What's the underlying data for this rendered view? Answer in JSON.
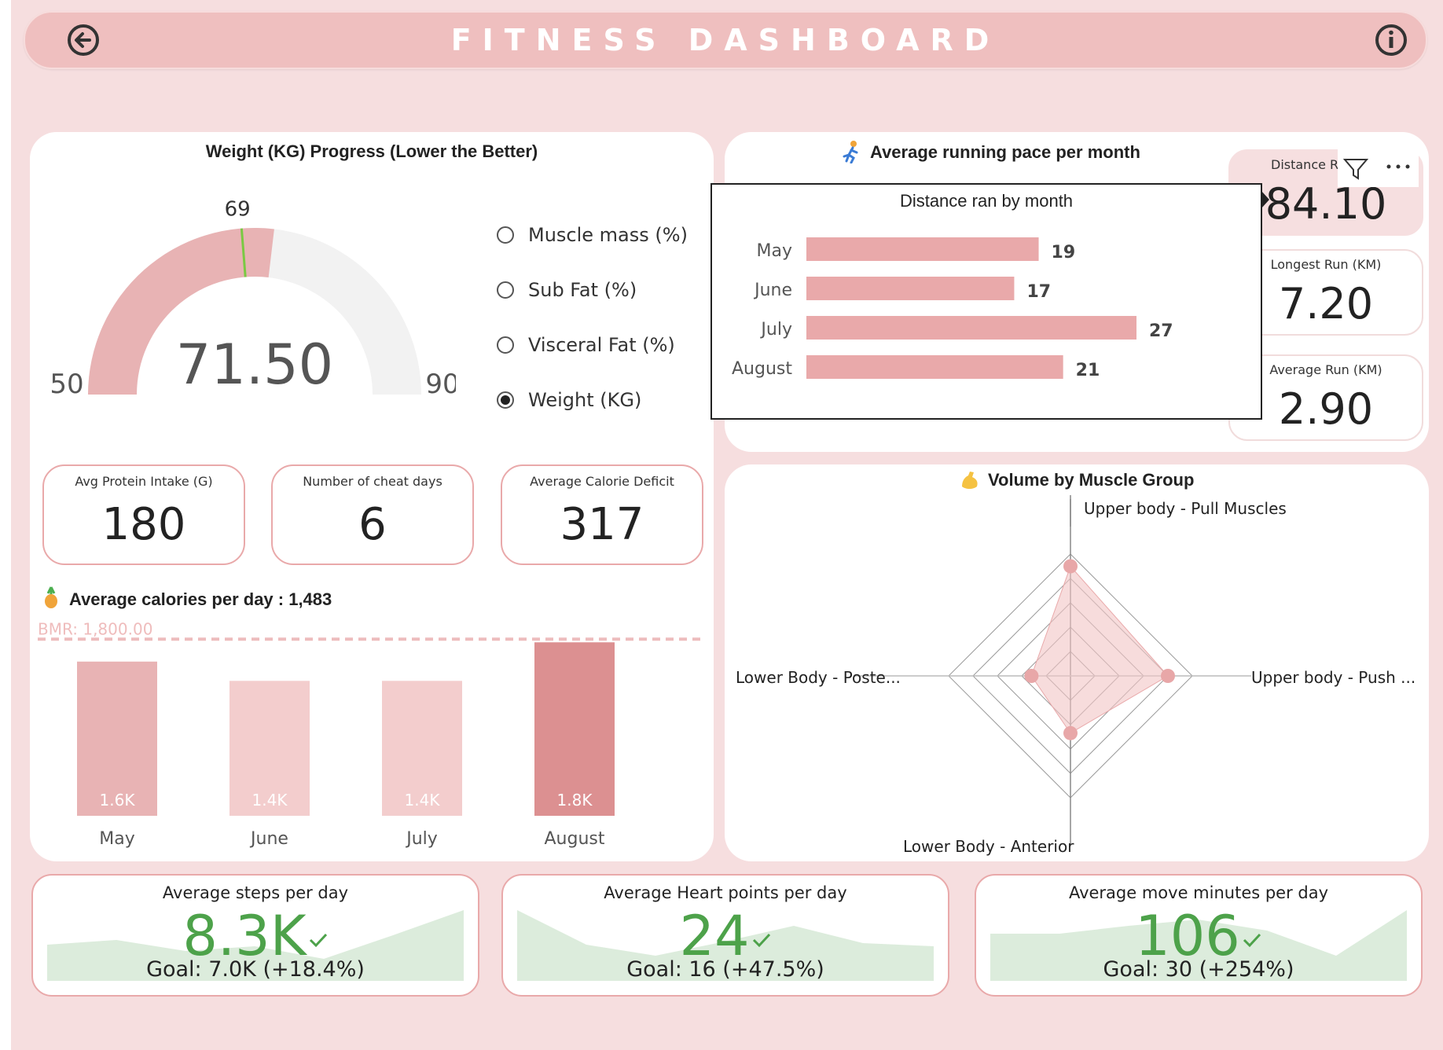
{
  "header": {
    "title": "FITNESS DASHBOARD",
    "back_icon": "back-arrow-icon",
    "info_icon": "info-icon"
  },
  "weight": {
    "title": "Weight (KG) Progress (Lower the Better)",
    "value": "71.50",
    "min": "50",
    "max": "90",
    "target": "69",
    "value_num": 71.5,
    "min_num": 50,
    "max_num": 90,
    "target_num": 69,
    "colors": {
      "fill": "#e8b3b4",
      "track": "#f2f2f2",
      "target": "#7ac943"
    }
  },
  "metric_options": [
    {
      "label": "Muscle mass (%)",
      "selected": false
    },
    {
      "label": "Sub Fat (%)",
      "selected": false
    },
    {
      "label": "Visceral Fat (%)",
      "selected": false
    },
    {
      "label": "Weight (KG)",
      "selected": true
    }
  ],
  "kpis": [
    {
      "label": "Avg Protein Intake (G)",
      "value": "180"
    },
    {
      "label": "Number of cheat days",
      "value": "6"
    },
    {
      "label": "Average Calorie Deficit",
      "value": "317"
    }
  ],
  "calories": {
    "title": "Average calories per day : 1,483",
    "bmr_label": "BMR: 1,800.00",
    "icon": "pineapple-icon"
  },
  "running": {
    "title": "Average running pace per month",
    "icon": "runner-icon",
    "popup_title": "Distance ran by month",
    "distance_label": "Distance R",
    "distance_value": "84.10",
    "longest_label": "Longest Run (KM)",
    "longest_value": "7.20",
    "average_label": "Average Run (KM)",
    "average_value": "2.90",
    "filter_icon": "filter-icon",
    "more_icon": "more-options-icon"
  },
  "muscle": {
    "title": "Volume by Muscle Group",
    "icon": "flexed-biceps-icon",
    "axes": [
      "Upper body - Pull Muscles",
      "Upper body - Push ...",
      "Lower Body - Anterior",
      "Lower Body - Poste..."
    ]
  },
  "bottom": [
    {
      "label": "Average steps per day",
      "value": "8.3K",
      "goal": "Goal: 7.0K (+18.4%)",
      "check_icon": "checkmark-icon"
    },
    {
      "label": "Average Heart points per day",
      "value": "24",
      "goal": "Goal: 16 (+47.5%)",
      "check_icon": "checkmark-icon"
    },
    {
      "label": "Average move minutes per day",
      "value": "106",
      "goal": "Goal: 30 (+254%)",
      "check_icon": "checkmark-icon"
    }
  ],
  "chart_data": [
    {
      "type": "bar",
      "categories": [
        "May",
        "June",
        "July",
        "August"
      ],
      "values": [
        1600,
        1400,
        1400,
        1800
      ],
      "labels": [
        "1.6K",
        "1.4K",
        "1.4K",
        "1.8K"
      ],
      "reference_line": {
        "label": "BMR: 1,800.00",
        "value": 1800
      },
      "ylim": [
        0,
        1900
      ],
      "colors": [
        "#e8b3b4",
        "#f3cdcd",
        "#f3cdcd",
        "#dc9091"
      ]
    },
    {
      "type": "bar",
      "orientation": "horizontal",
      "title": "Distance ran by month",
      "categories": [
        "May",
        "June",
        "July",
        "August"
      ],
      "values": [
        19,
        17,
        27,
        21
      ],
      "xlim": [
        0,
        27
      ]
    },
    {
      "type": "radar",
      "axes": [
        "Upper body - Pull Muscles",
        "Upper body - Push ...",
        "Lower Body - Anterior",
        "Lower Body - Poste..."
      ],
      "values": [
        0.9,
        0.8,
        0.47,
        0.32
      ]
    }
  ]
}
